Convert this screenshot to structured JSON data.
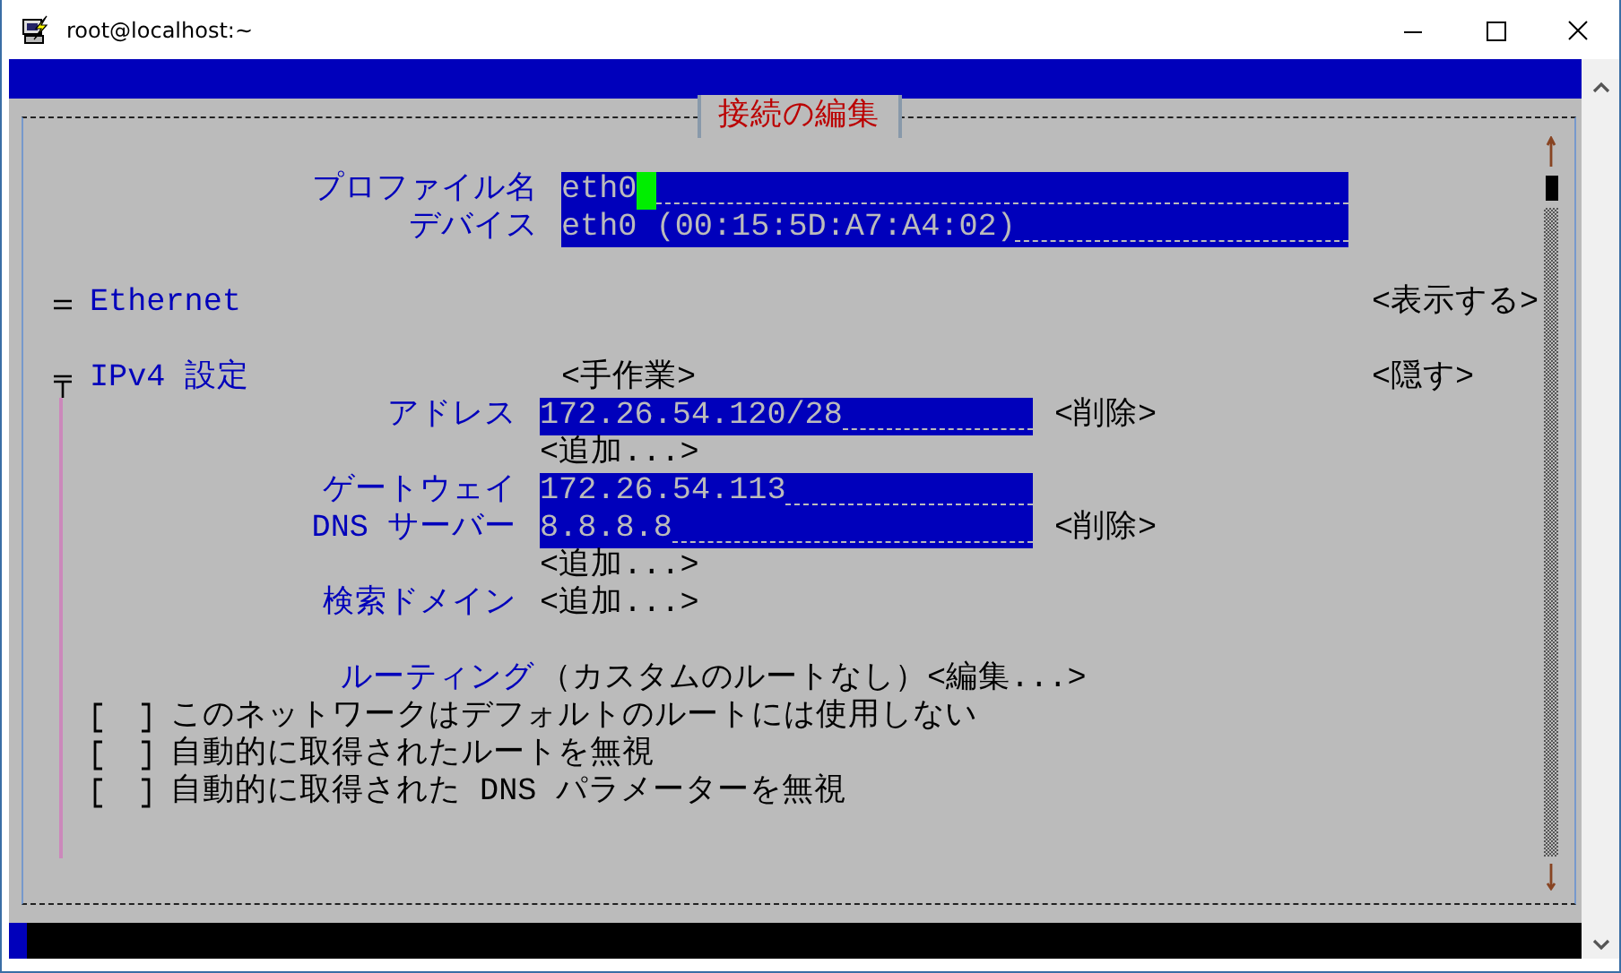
{
  "window": {
    "title": "root@localhost:~"
  },
  "dialog": {
    "title": "接続の編集"
  },
  "fields": [
    {
      "label": "プロファイル名",
      "value": "eth0",
      "focused": true
    },
    {
      "label": "デバイス",
      "value": "eth0 (00:15:5D:A7:A4:02)",
      "focused": false
    }
  ],
  "sections": [
    {
      "title": "Ethernet",
      "expanded": false,
      "toggle": "<表示する>"
    },
    {
      "title": "IPv4 設定",
      "expanded": true,
      "mode": "<手作業>",
      "toggle": "<隠す>",
      "rows": [
        {
          "kind": "field",
          "label": "アドレス",
          "value": "172.26.54.120/28",
          "button": "<削除>"
        },
        {
          "kind": "button",
          "button": "<追加...>"
        },
        {
          "kind": "field",
          "label": "ゲートウェイ",
          "value": "172.26.54.113"
        },
        {
          "kind": "field",
          "label": "DNS サーバー",
          "value": "8.8.8.8",
          "button": "<削除>"
        },
        {
          "kind": "button",
          "button": "<追加...>"
        },
        {
          "kind": "button",
          "label": "検索ドメイン",
          "button": "<追加...>"
        },
        {
          "kind": "route",
          "label": "ルーティング",
          "value": "（カスタムのルートなし）",
          "button": "<編集...>"
        },
        {
          "kind": "checkbox",
          "checked": false,
          "label": "このネットワークはデフォルトのルートには使用しない"
        },
        {
          "kind": "checkbox",
          "checked": false,
          "label": "自動的に取得されたルートを無視"
        },
        {
          "kind": "checkbox",
          "checked": false,
          "label": "自動的に取得された DNS パラメーターを無視"
        }
      ]
    }
  ]
}
